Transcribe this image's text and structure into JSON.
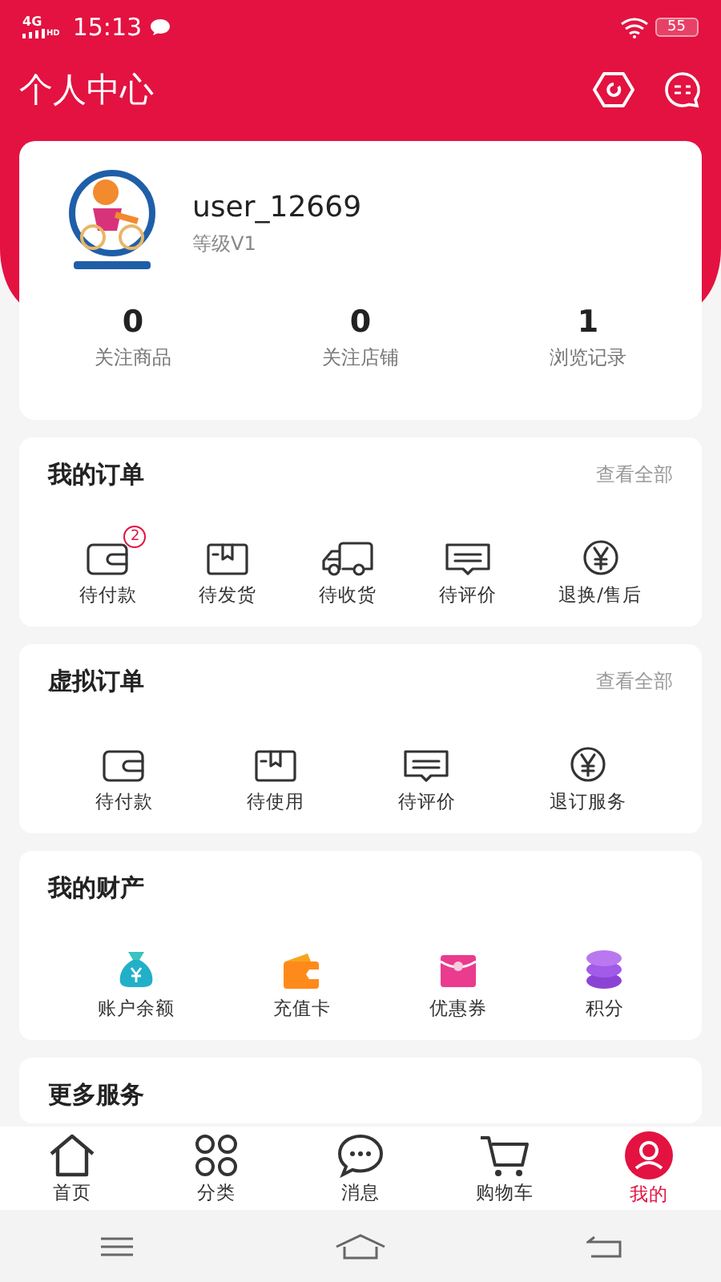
{
  "status_bar": {
    "network": "4G",
    "network_sup": "HD",
    "time": "15:13",
    "battery": "55"
  },
  "header": {
    "title": "个人中心"
  },
  "profile": {
    "username": "user_12669",
    "level": "等级V1",
    "stats": [
      {
        "value": "0",
        "label": "关注商品"
      },
      {
        "value": "0",
        "label": "关注店铺"
      },
      {
        "value": "1",
        "label": "浏览记录"
      }
    ]
  },
  "sections": [
    {
      "title": "我的订单",
      "more": "查看全部",
      "items": [
        {
          "label": "待付款",
          "kind": "wallet",
          "badge": "2"
        },
        {
          "label": "待发货",
          "kind": "box"
        },
        {
          "label": "待收货",
          "kind": "truck"
        },
        {
          "label": "待评价",
          "kind": "comment"
        },
        {
          "label": "退换/售后",
          "kind": "yen"
        }
      ]
    },
    {
      "title": "虚拟订单",
      "more": "查看全部",
      "items": [
        {
          "label": "待付款",
          "kind": "wallet"
        },
        {
          "label": "待使用",
          "kind": "box"
        },
        {
          "label": "待评价",
          "kind": "comment"
        },
        {
          "label": "退订服务",
          "kind": "yen"
        }
      ]
    },
    {
      "title": "我的财产",
      "items": [
        {
          "label": "账户余额",
          "kind": "moneybag"
        },
        {
          "label": "充值卡",
          "kind": "card"
        },
        {
          "label": "优惠券",
          "kind": "coupon"
        },
        {
          "label": "积分",
          "kind": "coins"
        }
      ]
    },
    {
      "title": "更多服务"
    }
  ],
  "tab_bar": [
    {
      "label": "首页",
      "kind": "home",
      "selected": false
    },
    {
      "label": "分类",
      "kind": "grid",
      "selected": false
    },
    {
      "label": "消息",
      "kind": "chat",
      "selected": false
    },
    {
      "label": "购物车",
      "kind": "cart",
      "selected": false
    },
    {
      "label": "我的",
      "kind": "user",
      "selected": true
    }
  ]
}
